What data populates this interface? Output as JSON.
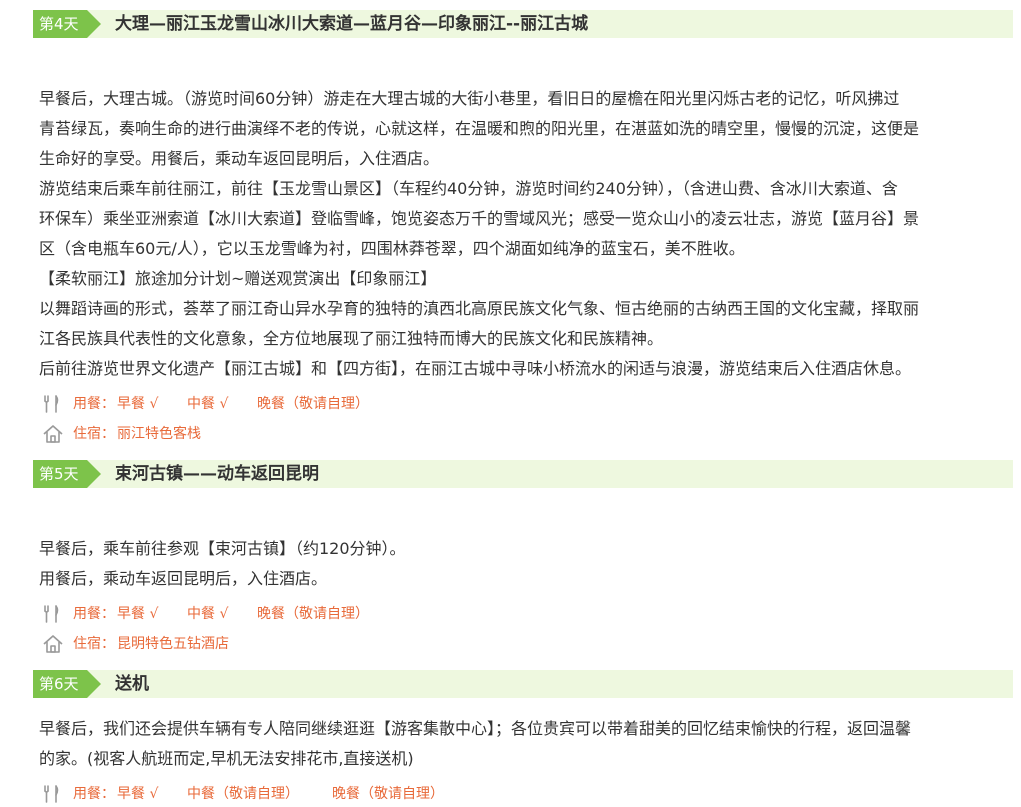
{
  "colors": {
    "accent_green": "#7dc34a",
    "header_bg": "#eef8df",
    "meal_text": "#e86a3a"
  },
  "days": [
    {
      "tag": "第4天",
      "title": "大理—丽江玉龙雪山冰川大索道—蓝月谷—印象丽江--丽江古城",
      "lines": [
        "早餐后，大理古城。（游览时间60分钟）游走在大理古城的大街小巷里，看旧日的屋檐在阳光里闪烁古老的记忆，听风拂过",
        "青苔绿瓦，奏响生命的进行曲演绎不老的传说，心就这样，在温暖和煦的阳光里，在湛蓝如洗的晴空里，慢慢的沉淀，这便是",
        "生命好的享受。用餐后，乘动车返回昆明后，入住酒店。",
        "游览结束后乘车前往丽江，前往【玉龙雪山景区】（车程约40分钟，游览时间约240分钟），（含进山费、含冰川大索道、含",
        "环保车）乘坐亚洲索道【冰川大索道】登临雪峰，饱览姿态万千的雪域风光；感受一览众山小的凌云壮志，游览【蓝月谷】景",
        "区（含电瓶车60元/人），它以玉龙雪峰为衬，四围林莽苍翠，四个湖面如纯净的蓝宝石，美不胜收。",
        "【柔软丽江】旅途加分计划~赠送观赏演出【印象丽江】",
        "以舞蹈诗画的形式，荟萃了丽江奇山异水孕育的独特的滇西北高原民族文化气象、恒古绝丽的古纳西王国的文化宝藏，择取丽",
        "江各民族具代表性的文化意象，全方位地展现了丽江独特而博大的民族文化和民族精神。",
        "后前往游览世界文化遗产【丽江古城】和【四方街】，在丽江古城中寻味小桥流水的闲适与浪漫，游览结束后入住酒店休息。"
      ],
      "meal": {
        "label": "用餐：",
        "breakfast": "早餐 √",
        "lunch": "中餐 √",
        "dinner": "晚餐（敬请自理）"
      },
      "stay": {
        "label": "住宿：",
        "value": "丽江特色客栈"
      }
    },
    {
      "tag": "第5天",
      "title": "束河古镇——动车返回昆明",
      "lines": [
        "早餐后，乘车前往参观【束河古镇】（约120分钟）。",
        "用餐后，乘动车返回昆明后，入住酒店。"
      ],
      "meal": {
        "label": "用餐：",
        "breakfast": "早餐 √",
        "lunch": "中餐 √",
        "dinner": "晚餐（敬请自理）"
      },
      "stay": {
        "label": "住宿：",
        "value": "昆明特色五钻酒店"
      }
    },
    {
      "tag": "第6天",
      "title": "送机",
      "lines": [
        "早餐后，我们还会提供车辆有专人陪同继续逛逛【游客集散中心】；各位贵宾可以带着甜美的回忆结束愉快的行程，返回温馨",
        "的家。(视客人航班而定,早机无法安排花市,直接送机)"
      ],
      "meal": {
        "label": "用餐：",
        "breakfast": "早餐 √",
        "lunch": "中餐（敬请自理）",
        "dinner": "晚餐（敬请自理）"
      }
    }
  ]
}
